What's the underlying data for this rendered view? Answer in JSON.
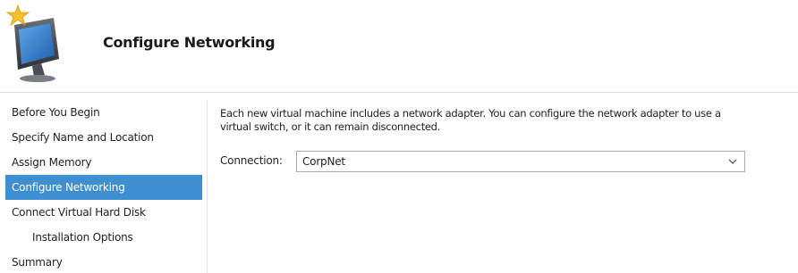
{
  "header": {
    "title": "Configure Networking",
    "icon": "new-virtual-machine-icon"
  },
  "sidebar": {
    "items": [
      {
        "label": "Before You Begin",
        "active": false,
        "sub": false
      },
      {
        "label": "Specify Name and Location",
        "active": false,
        "sub": false
      },
      {
        "label": "Assign Memory",
        "active": false,
        "sub": false
      },
      {
        "label": "Configure Networking",
        "active": true,
        "sub": false
      },
      {
        "label": "Connect Virtual Hard Disk",
        "active": false,
        "sub": false
      },
      {
        "label": "Installation Options",
        "active": false,
        "sub": true
      },
      {
        "label": "Summary",
        "active": false,
        "sub": false
      }
    ]
  },
  "main": {
    "description_line1": "Each new virtual machine includes a network adapter. You can configure the network adapter to use a",
    "description_line2": "virtual switch, or it can remain disconnected.",
    "connection_label": "Connection:",
    "connection_value": "CorpNet"
  },
  "colors": {
    "selection": "#3d8fd1",
    "text": "#1f1f1f",
    "border": "#ababab"
  }
}
